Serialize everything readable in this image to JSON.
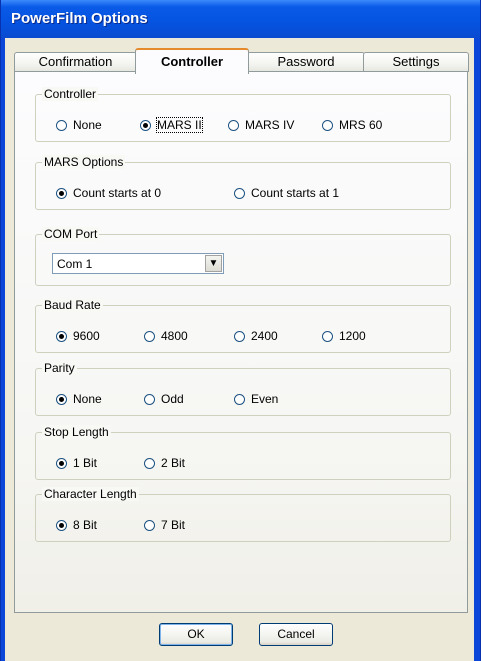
{
  "window": {
    "title": "PowerFilm Options"
  },
  "tabs": [
    {
      "label": "Confirmation"
    },
    {
      "label": "Controller"
    },
    {
      "label": "Password"
    },
    {
      "label": "Settings"
    }
  ],
  "controller": {
    "legend": "Controller",
    "options": [
      "None",
      "MARS II",
      "MARS IV",
      "MRS 60"
    ],
    "selected": "MARS II"
  },
  "mars_options": {
    "legend": "MARS Options",
    "options": [
      "Count starts at 0",
      "Count starts at 1"
    ],
    "selected": "Count starts at 0"
  },
  "com_port": {
    "legend": "COM Port",
    "value": "Com 1",
    "arrow": "▼"
  },
  "baud_rate": {
    "legend": "Baud Rate",
    "options": [
      "9600",
      "4800",
      "2400",
      "1200"
    ],
    "selected": "9600"
  },
  "parity": {
    "legend": "Parity",
    "options": [
      "None",
      "Odd",
      "Even"
    ],
    "selected": "None"
  },
  "stop_length": {
    "legend": "Stop Length",
    "options": [
      "1 Bit",
      "2 Bit"
    ],
    "selected": "1 Bit"
  },
  "char_length": {
    "legend": "Character Length",
    "options": [
      "8 Bit",
      "7 Bit"
    ],
    "selected": "8 Bit"
  },
  "buttons": {
    "ok": "OK",
    "cancel": "Cancel"
  }
}
